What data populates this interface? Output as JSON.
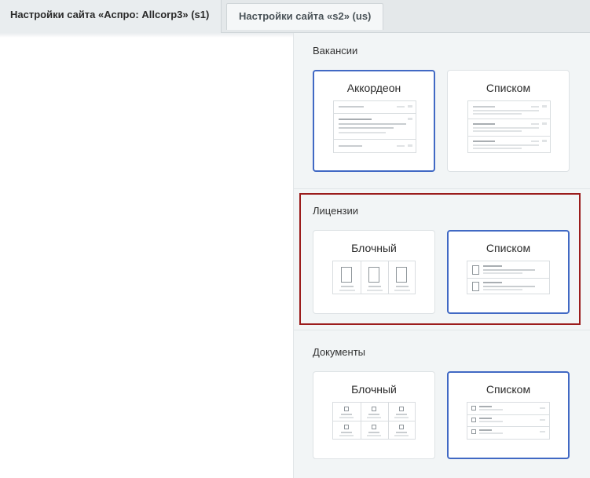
{
  "tabs": [
    {
      "label": "Настройки сайта «Аспро: Allcorp3» (s1)",
      "active": true
    },
    {
      "label": "Настройки сайта «s2» (us)",
      "active": false
    }
  ],
  "sections": {
    "vacancies": {
      "title": "Вакансии",
      "options": [
        {
          "label": "Аккордеон",
          "selected": true
        },
        {
          "label": "Списком",
          "selected": false
        }
      ]
    },
    "licenses": {
      "title": "Лицензии",
      "options": [
        {
          "label": "Блочный",
          "selected": false
        },
        {
          "label": "Списком",
          "selected": true
        }
      ]
    },
    "documents": {
      "title": "Документы",
      "options": [
        {
          "label": "Блочный",
          "selected": false
        },
        {
          "label": "Списком",
          "selected": true
        }
      ]
    }
  },
  "colors": {
    "selected_border": "#4169c4",
    "highlight_border": "#9b1c1c"
  }
}
